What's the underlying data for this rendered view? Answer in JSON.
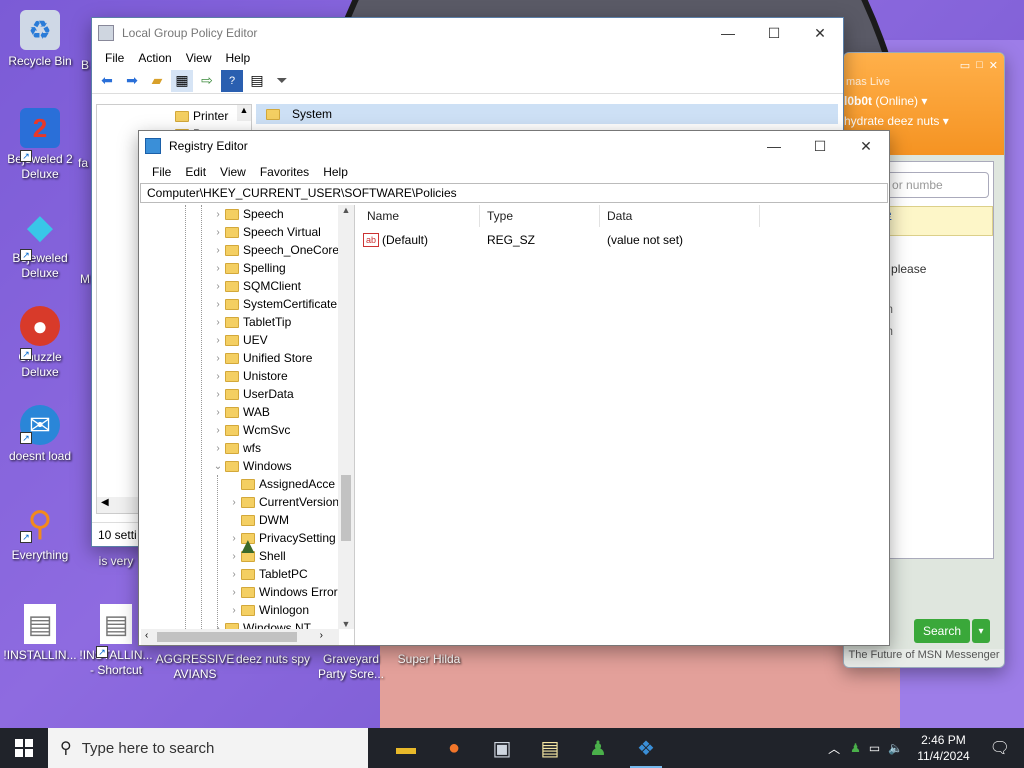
{
  "desktop": {
    "icons": [
      {
        "label": "Recycle Bin",
        "glyph": "🗑",
        "color": "#cfd8e6"
      },
      {
        "label": "Bejeweled 2 Deluxe",
        "glyph": "2",
        "color": "#2a6fd8"
      },
      {
        "label": "Bejeweled Deluxe",
        "glyph": "◆",
        "color": "#39c6e8"
      },
      {
        "label": "Chuzzle Deluxe",
        "glyph": "●",
        "color": "#d83a2a"
      },
      {
        "label": "doesnt load",
        "glyph": "◉",
        "color": "#2a86d8"
      },
      {
        "label": "Everything",
        "glyph": "○",
        "color": "#f28a1c"
      },
      {
        "label": "!INSTALLIN...",
        "glyph": "▤",
        "color": "#ffffff"
      },
      {
        "label": "!INSTALLIN... - Shortcut",
        "glyph": "▤",
        "color": "#ffffff"
      },
      {
        "label": "AGGRESSIVE AVIANS",
        "glyph": "",
        "color": ""
      },
      {
        "label": "deez nuts spy",
        "glyph": "",
        "color": ""
      },
      {
        "label": "Graveyard Party Scre...",
        "glyph": "",
        "color": ""
      },
      {
        "label": "Super Hilda",
        "glyph": "",
        "color": ""
      }
    ],
    "partial_labels": {
      "fa": "fa",
      "m": "M",
      "is_very": "is very",
      "b": "B"
    }
  },
  "gpe": {
    "title": "Local Group Policy Editor",
    "menu": [
      "File",
      "Action",
      "View",
      "Help"
    ],
    "tree_item": "Printer",
    "tree_item2": "P",
    "selected_item": "System",
    "status": "10 setti"
  },
  "msn": {
    "line1": "mas Live",
    "line2": "l0b0t",
    "status": "(Online)",
    "line3": "hydrate deez nuts",
    "search_placeholder": "contact or numbe",
    "link1": "bout the",
    "link2": "ce",
    "text1": "ssenger please",
    "email1": "mail.com",
    "email2": "mail.com",
    "text2": "cube",
    "search_btn": "Search",
    "footer": "The Future of MSN Messenger"
  },
  "registry": {
    "title": "Registry Editor",
    "menu": [
      "File",
      "Edit",
      "View",
      "Favorites",
      "Help"
    ],
    "address": "Computer\\HKEY_CURRENT_USER\\SOFTWARE\\Policies",
    "tree_top": [
      "Speech",
      "Speech Virtual",
      "Speech_OneCore",
      "Spelling",
      "SQMClient",
      "SystemCertificate",
      "TabletTip",
      "UEV",
      "Unified Store",
      "Unistore",
      "UserData",
      "WAB",
      "WcmSvc",
      "wfs",
      "Windows"
    ],
    "tree_children": [
      "AssignedAcce",
      "CurrentVersion",
      "DWM",
      "PrivacySetting",
      "Shell",
      "TabletPC",
      "Windows Error",
      "Winlogon"
    ],
    "tree_last": "Windows NT",
    "columns": {
      "name": "Name",
      "type": "Type",
      "data": "Data"
    },
    "values": [
      {
        "name": "(Default)",
        "type": "REG_SZ",
        "data": "(value not set)"
      }
    ]
  },
  "taskbar": {
    "search_placeholder": "Type here to search",
    "time": "2:46 PM",
    "date": "11/4/2024"
  }
}
